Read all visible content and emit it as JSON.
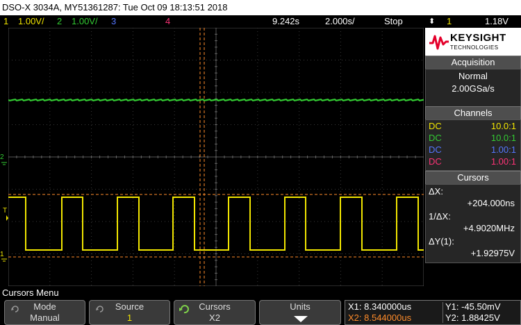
{
  "title_bar": {
    "text": "DSO-X 3034A, MY51361287: Tue Oct 09 18:13:51 2018"
  },
  "status_row": {
    "ch1_num": "1",
    "ch1_scale": "1.00V/",
    "ch2_num": "2",
    "ch2_scale": "1.00V/",
    "ch3_num": "3",
    "ch4_num": "4",
    "time_pos": "9.242s",
    "time_scale": "2.000s/",
    "run_state": "Stop",
    "trig_icon": "⬍",
    "trig_ch": "1",
    "trig_level": "1.18V"
  },
  "brand": {
    "name": "KEYSIGHT",
    "sub": "TECHNOLOGIES"
  },
  "acquisition": {
    "header": "Acquisition",
    "mode": "Normal",
    "rate": "2.00GSa/s"
  },
  "channels": {
    "header": "Channels",
    "rows": [
      {
        "coupling": "DC",
        "probe": "10.0:1",
        "color": "#f2e600"
      },
      {
        "coupling": "DC",
        "probe": "10.0:1",
        "color": "#33cc33"
      },
      {
        "coupling": "DC",
        "probe": "1.00:1",
        "color": "#5577ff"
      },
      {
        "coupling": "DC",
        "probe": "1.00:1",
        "color": "#ff3377"
      }
    ]
  },
  "cursors_panel": {
    "header": "Cursors",
    "dx_label": "ΔX:",
    "dx_value": "+204.000ns",
    "inv_label": "1/ΔX:",
    "inv_value": "+4.9020MHz",
    "dy_label": "ΔY(1):",
    "dy_value": "+1.92975V"
  },
  "menu": {
    "title": "Cursors Menu",
    "softkeys": [
      {
        "label": "Mode",
        "value": "Manual"
      },
      {
        "label": "Source",
        "value": "1"
      },
      {
        "label": "Cursors",
        "value": "X2"
      },
      {
        "label": "Units",
        "value": ""
      }
    ],
    "readout": {
      "x1": "X1: 8.340000us",
      "x2": "X2: 8.544000us",
      "y1": "Y1: -45.50mV",
      "y2": "Y2: 1.88425V"
    }
  },
  "waveforms": {
    "ch1": {
      "color": "#f2e600",
      "low_level": 0,
      "high_level": 1.93,
      "period_ns": 204,
      "duty": 0.5
    },
    "ch2": {
      "color": "#33cc33",
      "level": "flat"
    }
  },
  "colors": {
    "ch1": "#f2e600",
    "ch2": "#33cc33",
    "ch3": "#5577ff",
    "ch4": "#ff3377",
    "cursor": "#ff8c2a"
  }
}
